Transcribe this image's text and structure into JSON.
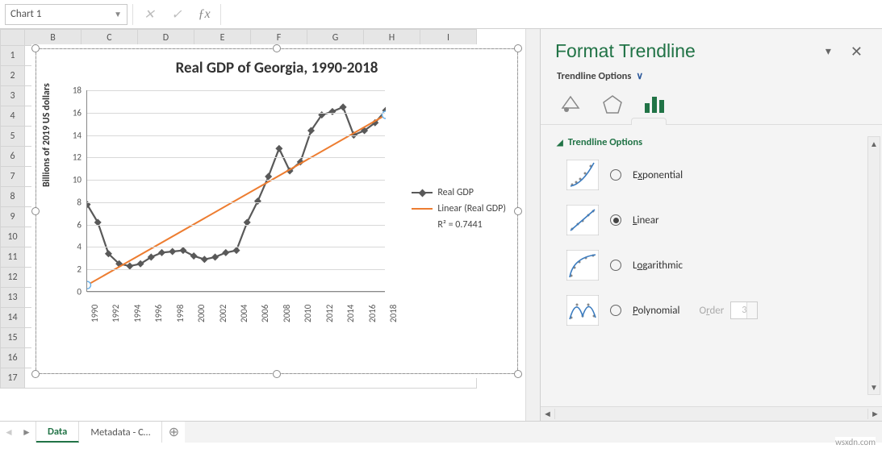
{
  "namebox": {
    "value": "Chart 1"
  },
  "formula_bar": {
    "cancel_tooltip": "Cancel",
    "enter_tooltip": "Enter",
    "fx_tooltip": "Insert Function"
  },
  "columns": [
    "B",
    "C",
    "D",
    "E",
    "F",
    "G",
    "H",
    "I"
  ],
  "rows": [
    "1",
    "2",
    "3",
    "4",
    "5",
    "6",
    "7",
    "8",
    "9",
    "10",
    "11",
    "12",
    "13",
    "14",
    "15",
    "16",
    "17"
  ],
  "chart_data": {
    "type": "line",
    "title": "Real GDP of Georgia, 1990-2018",
    "ylabel": "Billions of  2019 US dollars",
    "xlabel": "",
    "ylim": [
      0,
      18
    ],
    "yticks": [
      0,
      2,
      4,
      6,
      8,
      10,
      12,
      14,
      16,
      18
    ],
    "x": [
      1990,
      1991,
      1992,
      1993,
      1994,
      1995,
      1996,
      1997,
      1998,
      1999,
      2000,
      2001,
      2002,
      2003,
      2004,
      2005,
      2006,
      2007,
      2008,
      2009,
      2010,
      2011,
      2012,
      2013,
      2014,
      2015,
      2016,
      2017,
      2018
    ],
    "xticks": [
      1990,
      1992,
      1994,
      1996,
      1998,
      2000,
      2002,
      2004,
      2006,
      2008,
      2010,
      2012,
      2014,
      2016,
      2018
    ],
    "series": [
      {
        "name": "Real GDP",
        "values": [
          7.8,
          6.2,
          3.4,
          2.5,
          2.3,
          2.5,
          3.1,
          3.5,
          3.6,
          3.7,
          3.2,
          2.9,
          3.1,
          3.5,
          3.7,
          6.2,
          8.1,
          10.3,
          12.8,
          10.8,
          11.6,
          14.4,
          15.8,
          16.1,
          16.5,
          14.0,
          14.4,
          15.1,
          16.2
        ]
      }
    ],
    "trendline": {
      "name": "Linear (Real GDP)",
      "r2": 0.7441,
      "start": [
        1990,
        0.6
      ],
      "end": [
        2018,
        15.8
      ]
    },
    "legend": {
      "series_label": "Real GDP",
      "trend_label": "Linear (Real GDP)",
      "r2_label": "R² = 0.7441"
    }
  },
  "sheet_tabs": {
    "active": "Data",
    "tabs": [
      "Data",
      "Metadata - C…"
    ]
  },
  "pane": {
    "title": "Format Trendline",
    "section": "Trendline Options",
    "group": "Trendline Options",
    "options": {
      "exponential": "Exponential",
      "linear": "Linear",
      "logarithmic": "Logarithmic",
      "polynomial": "Polynomial",
      "order_label": "Order",
      "order_value": "3"
    },
    "selected": "linear"
  },
  "watermark": "wsxdn.com"
}
